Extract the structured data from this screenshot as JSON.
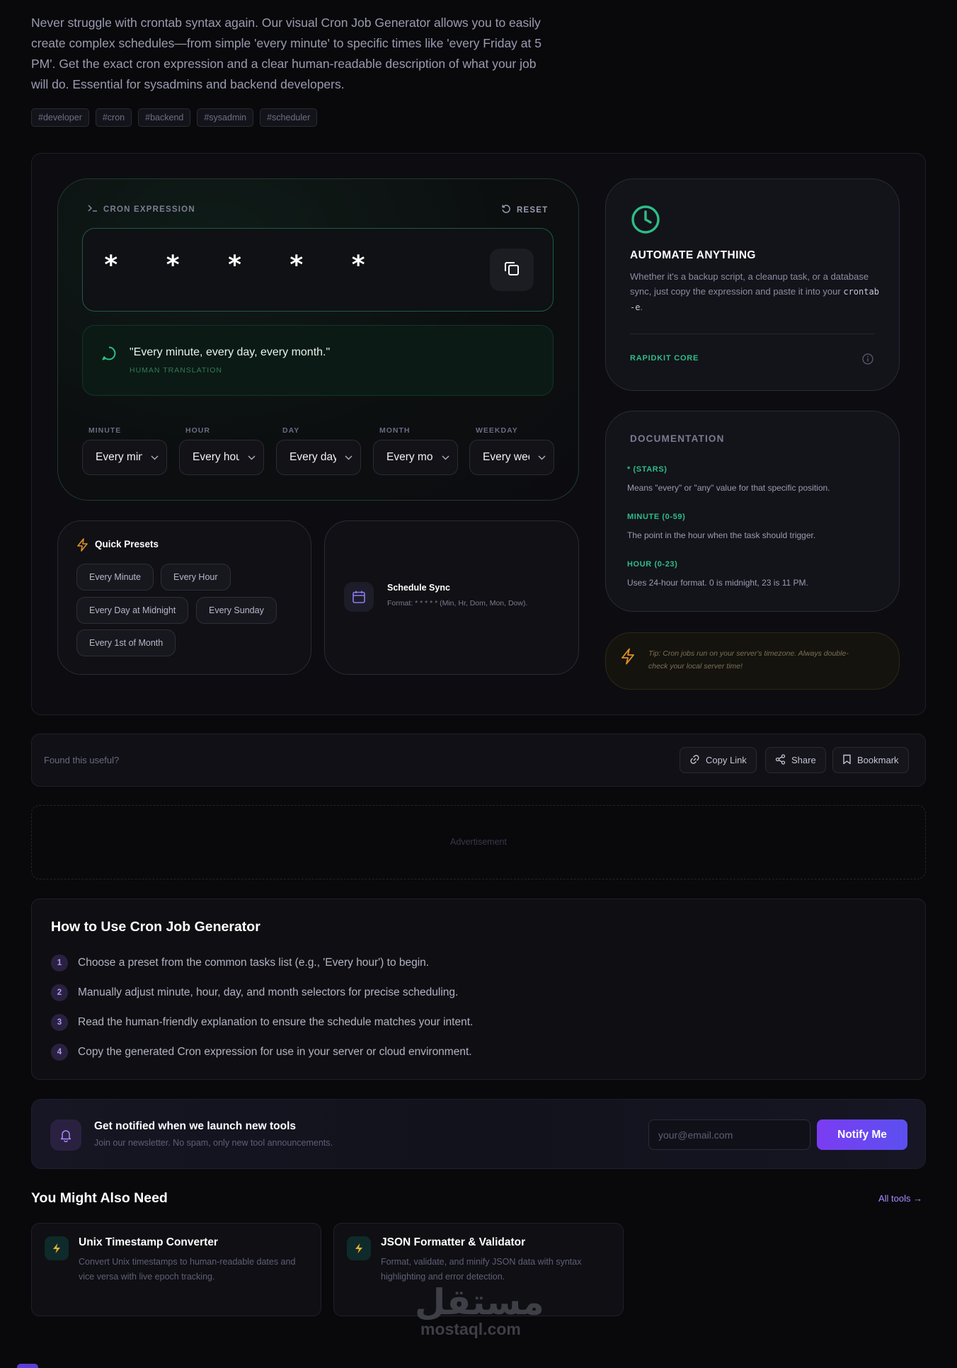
{
  "intro": {
    "text": "Never struggle with crontab syntax again. Our visual Cron Job Generator allows you to easily create complex schedules—from simple 'every minute' to specific times like 'every Friday at 5 PM'. Get the exact cron expression and a clear human-readable description of what your job will do. Essential for sysadmins and backend developers.",
    "tags": [
      "#developer",
      "#cron",
      "#backend",
      "#sysadmin",
      "#scheduler"
    ]
  },
  "cron": {
    "heading": "CRON EXPRESSION",
    "reset_label": "RESET",
    "expression": "* * * * *",
    "human_text": "\"Every minute, every day, every month.\"",
    "human_label": "HUMAN TRANSLATION",
    "fields": [
      {
        "label": "MINUTE",
        "value": "Every minute"
      },
      {
        "label": "HOUR",
        "value": "Every hour"
      },
      {
        "label": "DAY",
        "value": "Every day"
      },
      {
        "label": "MONTH",
        "value": "Every month"
      },
      {
        "label": "WEEKDAY",
        "value": "Every weekday"
      }
    ]
  },
  "automate": {
    "title": "AUTOMATE ANYTHING",
    "body_pre": "Whether it's a backup script, a cleanup task, or a database sync, just copy the expression and paste it into your ",
    "body_code": "crontab -e",
    "body_post": ".",
    "footer": "RAPIDKIT CORE"
  },
  "docs": {
    "title": "DOCUMENTATION",
    "items": [
      {
        "heading": "* (STARS)",
        "text": "Means \"every\" or \"any\" value for that specific position."
      },
      {
        "heading": "MINUTE (0-59)",
        "text": "The point in the hour when the task should trigger."
      },
      {
        "heading": "HOUR (0-23)",
        "text": "Uses 24-hour format. 0 is midnight, 23 is 11 PM."
      }
    ]
  },
  "tip": "Tip: Cron jobs run on your server's timezone. Always double-check your local server time!",
  "presets": {
    "title": "Quick Presets",
    "items": [
      "Every Minute",
      "Every Hour",
      "Every Day at Midnight",
      "Every Sunday",
      "Every 1st of Month"
    ]
  },
  "sync": {
    "title": "Schedule Sync",
    "subtitle": "Format: * * * * * (Min, Hr, Dom, Mon, Dow)."
  },
  "feedback": {
    "question": "Found this useful?",
    "copy_link": "Copy Link",
    "share": "Share",
    "bookmark": "Bookmark"
  },
  "ad_label": "Advertisement",
  "howto": {
    "title": "How to Use Cron Job Generator",
    "steps": [
      {
        "num": "1",
        "text": "Choose a preset from the common tasks list (e.g., 'Every hour') to begin."
      },
      {
        "num": "2",
        "text": "Manually adjust minute, hour, day, and month selectors for precise scheduling."
      },
      {
        "num": "3",
        "text": "Read the human-friendly explanation to ensure the schedule matches your intent."
      },
      {
        "num": "4",
        "text": "Copy the generated Cron expression for use in your server or cloud environment."
      }
    ]
  },
  "newsletter": {
    "title": "Get notified when we launch new tools",
    "subtitle": "Join our newsletter. No spam, only new tool announcements.",
    "placeholder": "your@email.com",
    "button": "Notify Me"
  },
  "related": {
    "title": "You Might Also Need",
    "all_tools": "All tools →",
    "items": [
      {
        "name": "Unix Timestamp Converter",
        "desc": "Convert Unix timestamps to human-readable dates and vice versa with live epoch tracking."
      },
      {
        "name": "JSON Formatter & Validator",
        "desc": "Format, validate, and minify JSON data with syntax highlighting and error detection."
      }
    ]
  },
  "watermark": {
    "logo": "مستقل",
    "text": "mostaql.com"
  },
  "colors": {
    "accent": "#2dbe85",
    "brand": "#7b3cf2",
    "warning": "#e0902a"
  }
}
